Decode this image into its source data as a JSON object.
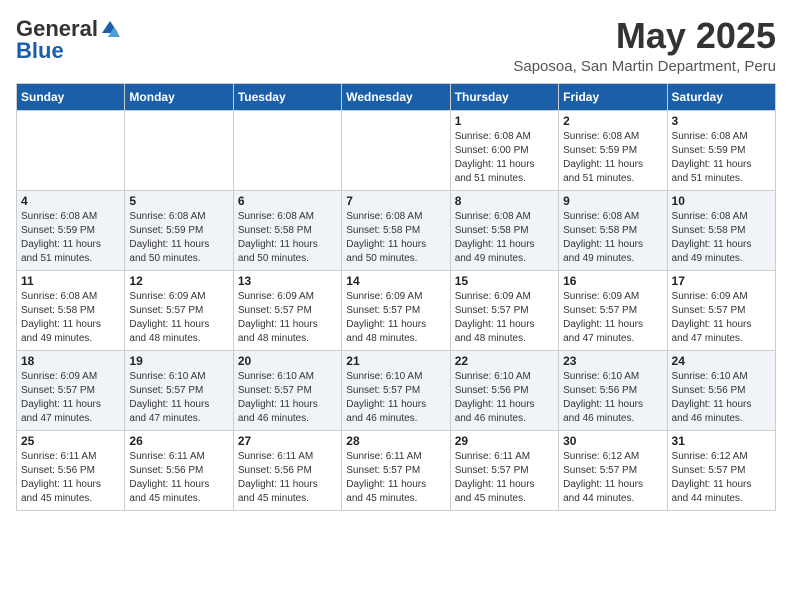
{
  "logo": {
    "general": "General",
    "blue": "Blue"
  },
  "title": {
    "month": "May 2025",
    "location": "Saposoa, San Martin Department, Peru"
  },
  "days_of_week": [
    "Sunday",
    "Monday",
    "Tuesday",
    "Wednesday",
    "Thursday",
    "Friday",
    "Saturday"
  ],
  "weeks": [
    [
      {
        "day": "",
        "info": ""
      },
      {
        "day": "",
        "info": ""
      },
      {
        "day": "",
        "info": ""
      },
      {
        "day": "",
        "info": ""
      },
      {
        "day": "1",
        "info": "Sunrise: 6:08 AM\nSunset: 6:00 PM\nDaylight: 11 hours\nand 51 minutes."
      },
      {
        "day": "2",
        "info": "Sunrise: 6:08 AM\nSunset: 5:59 PM\nDaylight: 11 hours\nand 51 minutes."
      },
      {
        "day": "3",
        "info": "Sunrise: 6:08 AM\nSunset: 5:59 PM\nDaylight: 11 hours\nand 51 minutes."
      }
    ],
    [
      {
        "day": "4",
        "info": "Sunrise: 6:08 AM\nSunset: 5:59 PM\nDaylight: 11 hours\nand 51 minutes."
      },
      {
        "day": "5",
        "info": "Sunrise: 6:08 AM\nSunset: 5:59 PM\nDaylight: 11 hours\nand 50 minutes."
      },
      {
        "day": "6",
        "info": "Sunrise: 6:08 AM\nSunset: 5:58 PM\nDaylight: 11 hours\nand 50 minutes."
      },
      {
        "day": "7",
        "info": "Sunrise: 6:08 AM\nSunset: 5:58 PM\nDaylight: 11 hours\nand 50 minutes."
      },
      {
        "day": "8",
        "info": "Sunrise: 6:08 AM\nSunset: 5:58 PM\nDaylight: 11 hours\nand 49 minutes."
      },
      {
        "day": "9",
        "info": "Sunrise: 6:08 AM\nSunset: 5:58 PM\nDaylight: 11 hours\nand 49 minutes."
      },
      {
        "day": "10",
        "info": "Sunrise: 6:08 AM\nSunset: 5:58 PM\nDaylight: 11 hours\nand 49 minutes."
      }
    ],
    [
      {
        "day": "11",
        "info": "Sunrise: 6:08 AM\nSunset: 5:58 PM\nDaylight: 11 hours\nand 49 minutes."
      },
      {
        "day": "12",
        "info": "Sunrise: 6:09 AM\nSunset: 5:57 PM\nDaylight: 11 hours\nand 48 minutes."
      },
      {
        "day": "13",
        "info": "Sunrise: 6:09 AM\nSunset: 5:57 PM\nDaylight: 11 hours\nand 48 minutes."
      },
      {
        "day": "14",
        "info": "Sunrise: 6:09 AM\nSunset: 5:57 PM\nDaylight: 11 hours\nand 48 minutes."
      },
      {
        "day": "15",
        "info": "Sunrise: 6:09 AM\nSunset: 5:57 PM\nDaylight: 11 hours\nand 48 minutes."
      },
      {
        "day": "16",
        "info": "Sunrise: 6:09 AM\nSunset: 5:57 PM\nDaylight: 11 hours\nand 47 minutes."
      },
      {
        "day": "17",
        "info": "Sunrise: 6:09 AM\nSunset: 5:57 PM\nDaylight: 11 hours\nand 47 minutes."
      }
    ],
    [
      {
        "day": "18",
        "info": "Sunrise: 6:09 AM\nSunset: 5:57 PM\nDaylight: 11 hours\nand 47 minutes."
      },
      {
        "day": "19",
        "info": "Sunrise: 6:10 AM\nSunset: 5:57 PM\nDaylight: 11 hours\nand 47 minutes."
      },
      {
        "day": "20",
        "info": "Sunrise: 6:10 AM\nSunset: 5:57 PM\nDaylight: 11 hours\nand 46 minutes."
      },
      {
        "day": "21",
        "info": "Sunrise: 6:10 AM\nSunset: 5:57 PM\nDaylight: 11 hours\nand 46 minutes."
      },
      {
        "day": "22",
        "info": "Sunrise: 6:10 AM\nSunset: 5:56 PM\nDaylight: 11 hours\nand 46 minutes."
      },
      {
        "day": "23",
        "info": "Sunrise: 6:10 AM\nSunset: 5:56 PM\nDaylight: 11 hours\nand 46 minutes."
      },
      {
        "day": "24",
        "info": "Sunrise: 6:10 AM\nSunset: 5:56 PM\nDaylight: 11 hours\nand 46 minutes."
      }
    ],
    [
      {
        "day": "25",
        "info": "Sunrise: 6:11 AM\nSunset: 5:56 PM\nDaylight: 11 hours\nand 45 minutes."
      },
      {
        "day": "26",
        "info": "Sunrise: 6:11 AM\nSunset: 5:56 PM\nDaylight: 11 hours\nand 45 minutes."
      },
      {
        "day": "27",
        "info": "Sunrise: 6:11 AM\nSunset: 5:56 PM\nDaylight: 11 hours\nand 45 minutes."
      },
      {
        "day": "28",
        "info": "Sunrise: 6:11 AM\nSunset: 5:57 PM\nDaylight: 11 hours\nand 45 minutes."
      },
      {
        "day": "29",
        "info": "Sunrise: 6:11 AM\nSunset: 5:57 PM\nDaylight: 11 hours\nand 45 minutes."
      },
      {
        "day": "30",
        "info": "Sunrise: 6:12 AM\nSunset: 5:57 PM\nDaylight: 11 hours\nand 44 minutes."
      },
      {
        "day": "31",
        "info": "Sunrise: 6:12 AM\nSunset: 5:57 PM\nDaylight: 11 hours\nand 44 minutes."
      }
    ]
  ]
}
